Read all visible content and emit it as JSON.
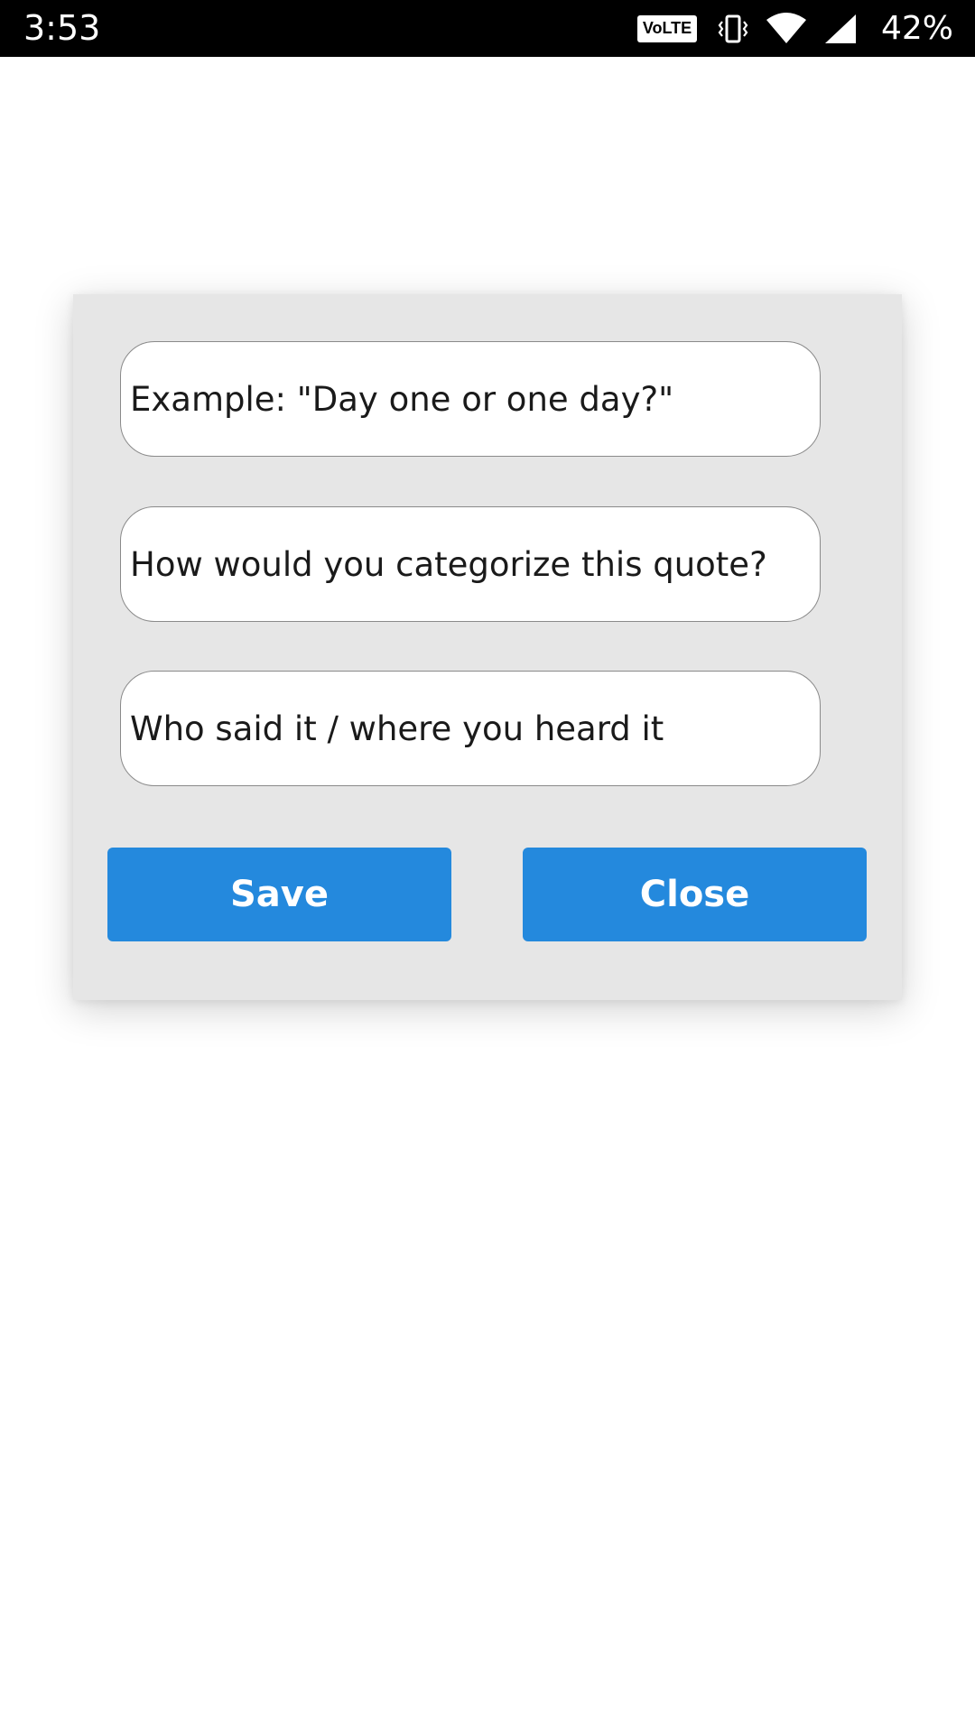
{
  "status_bar": {
    "time": "3:53",
    "volte": "VoLTE",
    "battery": "42%",
    "icons": [
      "volte-icon",
      "vibrate-icon",
      "wifi-icon",
      "signal-icon"
    ]
  },
  "dialog": {
    "fields": [
      {
        "placeholder": "Example: \"Day one or one day?\""
      },
      {
        "placeholder": "How would you categorize this quote?"
      },
      {
        "placeholder": "Who said it / where you heard it"
      }
    ],
    "save_label": "Save",
    "close_label": "Close"
  },
  "colors": {
    "button": "#2489dd",
    "dialog_bg": "#e6e6e6",
    "status_bar": "#000000"
  }
}
